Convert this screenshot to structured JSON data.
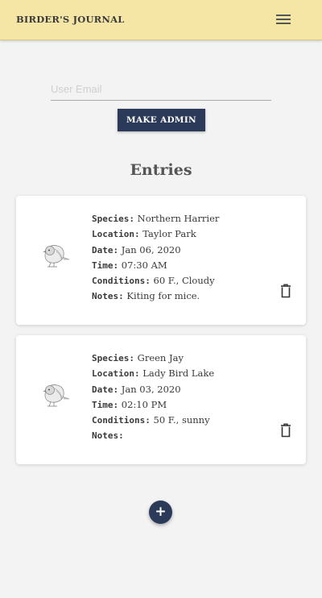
{
  "app": {
    "title": "BIRDER'S JOURNAL",
    "menu_icon": "hamburger-menu-icon"
  },
  "admin": {
    "email_placeholder": "User Email",
    "email_value": "",
    "make_admin_label": "MAKE ADMIN"
  },
  "entries_title": "Entries",
  "labels": {
    "species": "Species:",
    "location": "Location:",
    "date": "Date:",
    "time": "Time:",
    "conditions": "Conditions:",
    "notes": "Notes:"
  },
  "entries": [
    {
      "species": "Northern Harrier",
      "location": "Taylor Park",
      "date": "Jan 06, 2020",
      "time": "07:30 AM",
      "conditions": "60 F., Cloudy",
      "notes": "Kiting for mice."
    },
    {
      "species": "Green Jay",
      "location": "Lady Bird Lake",
      "date": "Jan 03, 2020",
      "time": "02:10 PM",
      "conditions": "50 F., sunny",
      "notes": ""
    }
  ],
  "icons": {
    "bird": "bird-sketch-icon",
    "delete": "trash-icon",
    "add": "plus-icon"
  },
  "fab_label": "+",
  "colors": {
    "appbar": "#f5e6a6",
    "primary": "#2c3a5a",
    "background": "#f3f3f3"
  }
}
